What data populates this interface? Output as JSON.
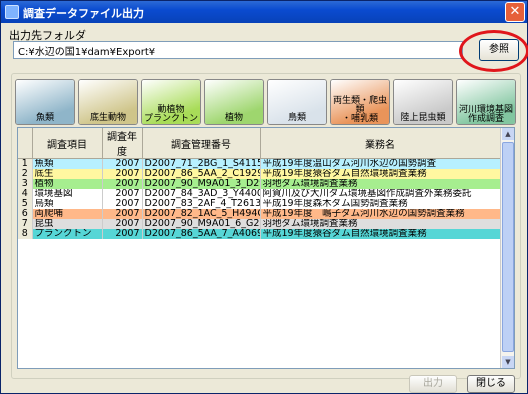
{
  "window": {
    "title": "調査データファイル出力",
    "close_glyph": "✕"
  },
  "output": {
    "label": "出力先フォルダ",
    "path": "C:¥水辺の国1¥dam¥Export¥",
    "ref_label": "参照"
  },
  "tiles": [
    {
      "label": "魚類",
      "color": "#8fb5c9"
    },
    {
      "label": "底生動物",
      "color": "#cfc58a"
    },
    {
      "label": "動植物プランクトン",
      "label_lines": [
        "動植物",
        "プランクトン"
      ],
      "color": "#a8dc58"
    },
    {
      "label": "植物",
      "color": "#9ed66e"
    },
    {
      "label": "鳥類",
      "color": "#d9e2ea"
    },
    {
      "label": "両生類・爬虫類・哺乳類",
      "label_lines": [
        "両生類・爬虫類",
        "・哺乳類"
      ],
      "color": "#e9945a"
    },
    {
      "label": "陸上昆虫類",
      "color": "#c9c9c9"
    },
    {
      "label": "河川環境基図作成調査",
      "label_lines": [
        "河川環境基図",
        "作成調査"
      ],
      "color": "#82c6a0"
    }
  ],
  "table": {
    "headers": [
      "",
      "調査項目",
      "調査年度",
      "調査管理番号",
      "業務名"
    ],
    "rows": [
      {
        "num": "1",
        "item": "魚類",
        "year": "2007",
        "id": "D2007_71_2BG_1_S4115",
        "name": "平成19年度温山ダム河川水辺の国勢調査",
        "color": "#b7f0ff"
      },
      {
        "num": "2",
        "item": "底生",
        "year": "2007",
        "id": "D2007_86_5AA_2_C1929",
        "name": "平成19年度猿谷ダム自然環境調査業務",
        "color": "#fff7a0"
      },
      {
        "num": "3",
        "item": "植物",
        "year": "2007",
        "id": "D2007_90_M9A01_3_D29",
        "name": "羽地ダム環境調査業務",
        "color": "#a6ee8f"
      },
      {
        "num": "4",
        "item": "環境基図",
        "year": "2007",
        "id": "D2007_84_3AD_3_Y4400",
        "name": "阿賀川及び大川ダム環境基図作成調査外業務委託",
        "color": "#ffffff"
      },
      {
        "num": "5",
        "item": "鳥類",
        "year": "2007",
        "id": "D2007_83_2AF_4_T2613",
        "name": "平成19年度森木ダム国勢調査業務",
        "color": "#ffffff"
      },
      {
        "num": "6",
        "item": "両爬哺",
        "year": "2007",
        "id": "D2007_82_1AC_5_H494C",
        "name": "平成19年度　嶋子ダム河川水辺の国勢調査業務",
        "color": "#ffb889"
      },
      {
        "num": "7",
        "item": "昆虫",
        "year": "2007",
        "id": "D2007_90_M9A01_6_G26",
        "name": "羽地ダム環境調査業務",
        "color": "#dedede"
      },
      {
        "num": "8",
        "item": "プランクトン",
        "year": "2007",
        "id": "D2007_86_5AA_7_A4069",
        "name": "平成19年度猿谷ダム自然環境調査業務",
        "color": "#56d6d6"
      }
    ]
  },
  "buttons": {
    "output": "出力",
    "close": "閉じる"
  }
}
